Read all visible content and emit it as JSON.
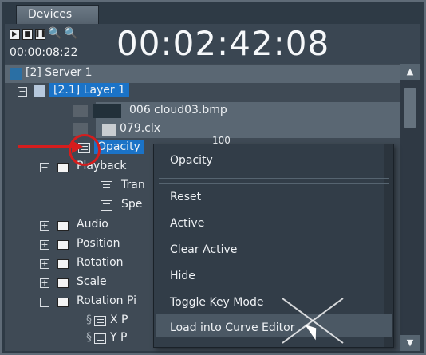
{
  "window": {
    "tab_label": "Devices"
  },
  "toolbar": {
    "current_time_small": "00:00:08:22",
    "current_time_big": "00:02:42:08",
    "buttons": [
      "play-icon",
      "stop-icon",
      "pause-icon",
      "zoom-in-icon",
      "zoom-out-icon"
    ]
  },
  "tree": {
    "server": "[2] Server 1",
    "layer": "[2.1] Layer 1",
    "media_file": "006 cloud03.bmp",
    "clx_file": "079.clx",
    "opacity_row": "Opacity",
    "playback_row": "Playback",
    "playback_children": [
      "Tran",
      "Spe"
    ],
    "folders": [
      "Audio",
      "Position",
      "Rotation",
      "Scale",
      "Rotation Pi"
    ],
    "rotation_pivot_children": [
      "X P",
      "Y P"
    ],
    "truncated_value": "100"
  },
  "context_menu": {
    "header": "Opacity",
    "items": [
      "Reset",
      "Active",
      "Clear Active",
      "Hide",
      "Toggle Key Mode",
      "Load into Curve Editor"
    ],
    "highlighted": "Load into Curve Editor"
  }
}
